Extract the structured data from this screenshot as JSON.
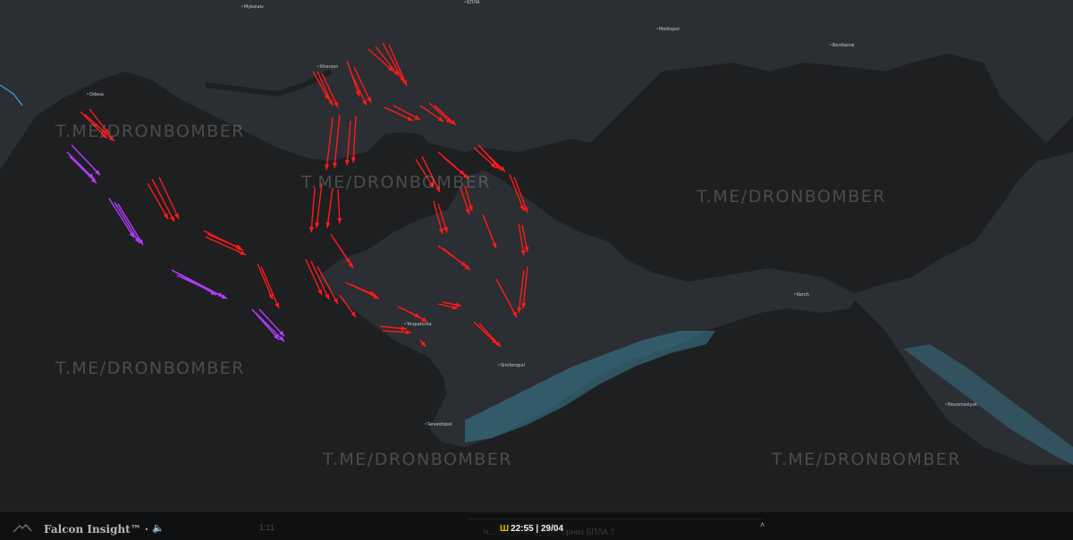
{
  "map": {
    "cities": [
      {
        "id": "mykolaiv",
        "label": "Mykolaiv"
      },
      {
        "id": "odesa",
        "label": "Odesa"
      },
      {
        "id": "kherson",
        "label": "Kherson"
      },
      {
        "id": "melitopol",
        "label": "Melitopol"
      },
      {
        "id": "berdiansk",
        "label": "Berdiansk"
      },
      {
        "id": "yevpatoriia",
        "label": "Yevpatoriia"
      },
      {
        "id": "simferopol",
        "label": "Simferopol"
      },
      {
        "id": "sevastopol",
        "label": "Sevastopol"
      },
      {
        "id": "kerch",
        "label": "Kerch"
      },
      {
        "id": "novorossiysk",
        "label": "Novorossiysk"
      },
      {
        "id": "top-partial",
        "label": "БПЛА"
      }
    ],
    "watermark": "T.ME/DRONBOMBER",
    "colors": {
      "land": "#2b2e32",
      "sea": "#1e1f21",
      "mountains": "#3a7f95",
      "red_track": "#ff1a1a",
      "purple_track": "#b33cff"
    },
    "legend_tracks": {
      "red": "red-tracks",
      "purple": "purple-tracks"
    }
  },
  "player": {
    "title": "Falcon Insight™ ·",
    "volume_icon": "speaker-icon",
    "time": "1:11"
  },
  "ticker": {
    "text": "Ч... напрямки руху ударних БПЛА ?",
    "time": "22:55 | 29/04",
    "trident": "trident-icon",
    "caret": "˄"
  }
}
